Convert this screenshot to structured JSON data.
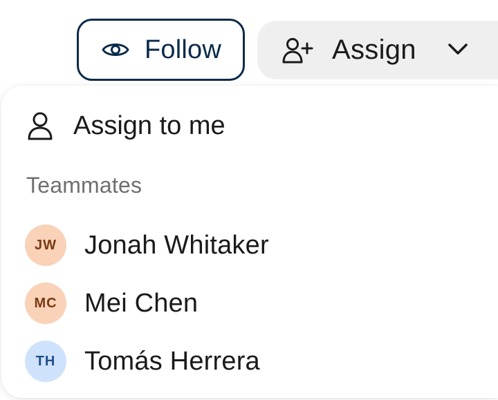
{
  "toolbar": {
    "follow_label": "Follow",
    "follow_icon": "eye-icon",
    "assign_label": "Assign",
    "assign_icon": "user-plus-icon",
    "assign_chevron_icon": "chevron-down-icon"
  },
  "menu": {
    "assign_to_me_label": "Assign to me",
    "assign_to_me_icon": "user-icon",
    "section_label": "Teammates",
    "teammates": [
      {
        "initials": "JW",
        "name": "Jonah Whitaker",
        "avatar_bg": "#f9d2b8",
        "avatar_fg": "#7a3a14"
      },
      {
        "initials": "MC",
        "name": "Mei Chen",
        "avatar_bg": "#f9d2b8",
        "avatar_fg": "#7a3a14"
      },
      {
        "initials": "TH",
        "name": "Tomás Herrera",
        "avatar_bg": "#cfe2fb",
        "avatar_fg": "#1f4f8a"
      }
    ]
  },
  "colors": {
    "follow_border": "#0b2a4a",
    "assign_bg": "#efefef",
    "section_text": "#6f6f6f"
  }
}
